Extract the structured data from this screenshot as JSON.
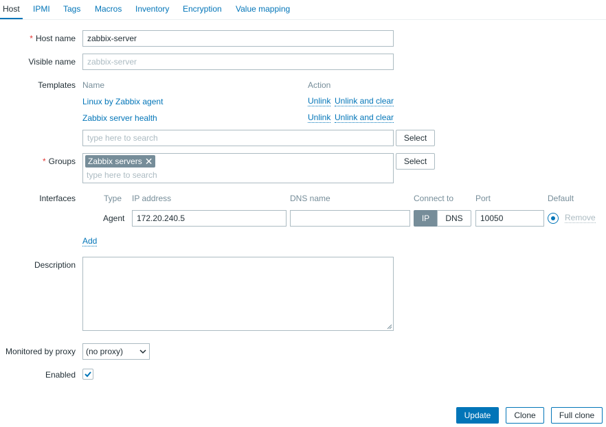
{
  "tabs": [
    "Host",
    "IPMI",
    "Tags",
    "Macros",
    "Inventory",
    "Encryption",
    "Value mapping"
  ],
  "form": {
    "required_mark": "*",
    "host_name": {
      "label": "Host name",
      "value": "zabbix-server"
    },
    "visible_name": {
      "label": "Visible name",
      "placeholder": "zabbix-server"
    },
    "templates": {
      "label": "Templates",
      "col_name": "Name",
      "col_action": "Action",
      "rows": [
        {
          "name": "Linux by Zabbix agent",
          "unlink": "Unlink",
          "unlink_clear": "Unlink and clear"
        },
        {
          "name": "Zabbix server health",
          "unlink": "Unlink",
          "unlink_clear": "Unlink and clear"
        }
      ],
      "search_placeholder": "type here to search",
      "select_label": "Select"
    },
    "groups": {
      "label": "Groups",
      "chip": "Zabbix servers",
      "chip_remove": "✕",
      "search_placeholder": "type here to search",
      "select_label": "Select"
    },
    "interfaces": {
      "label": "Interfaces",
      "headers": {
        "type": "Type",
        "ip": "IP address",
        "dns": "DNS name",
        "connect": "Connect to",
        "port": "Port",
        "default": "Default"
      },
      "row": {
        "type": "Agent",
        "ip": "172.20.240.5",
        "dns": "",
        "connect_ip": "IP",
        "connect_dns": "DNS",
        "connect_selected": "IP",
        "port": "10050",
        "remove": "Remove",
        "default": true
      },
      "add_label": "Add"
    },
    "description": {
      "label": "Description",
      "value": ""
    },
    "proxy": {
      "label": "Monitored by proxy",
      "value": "(no proxy)"
    },
    "enabled": {
      "label": "Enabled",
      "checked": true
    }
  },
  "buttons": {
    "update": "Update",
    "clone": "Clone",
    "full_clone": "Full clone"
  },
  "colors": {
    "accent": "#0275b8",
    "required": "#e33734",
    "muted": "#768d99"
  },
  "icons": {
    "check": "check-icon",
    "caret": "chevron-down-icon",
    "radio": "radio-selected-icon",
    "grip": "resize-grip-icon"
  }
}
